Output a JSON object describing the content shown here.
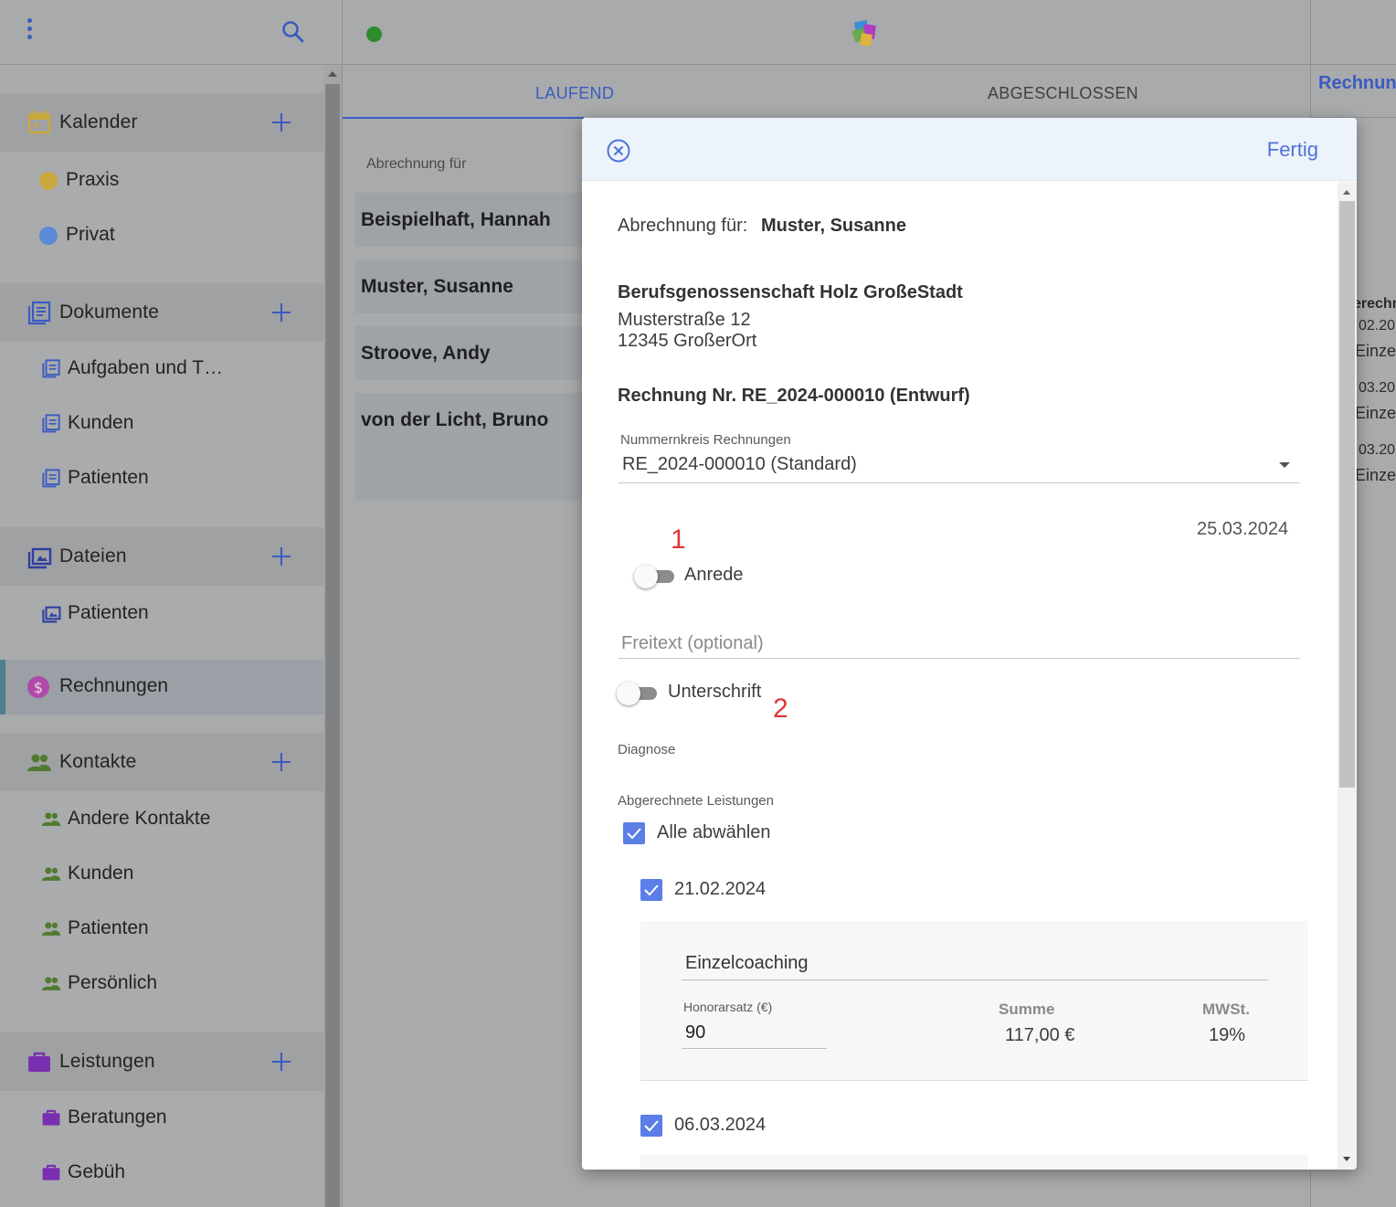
{
  "sidebar": {
    "groups": [
      {
        "label": "Kalender",
        "icon": "calendar-icon"
      },
      {
        "label": "Dokumente",
        "icon": "document-icon"
      },
      {
        "label": "Dateien",
        "icon": "files-icon"
      },
      {
        "label": "Kontakte",
        "icon": "contacts-icon"
      },
      {
        "label": "Leistungen",
        "icon": "briefcase-icon"
      }
    ],
    "calendars": [
      {
        "label": "Praxis",
        "color": "#c9a83f"
      },
      {
        "label": "Privat",
        "color": "#5b8ad6"
      }
    ],
    "documents": [
      {
        "label": "Aufgaben und T…"
      },
      {
        "label": "Kunden"
      },
      {
        "label": "Patienten"
      }
    ],
    "files": [
      {
        "label": "Patienten"
      }
    ],
    "active": {
      "label": "Rechnungen",
      "icon": "dollar-icon"
    },
    "contacts": [
      {
        "label": "Andere Kontakte"
      },
      {
        "label": "Kunden"
      },
      {
        "label": "Patienten"
      },
      {
        "label": "Persönlich"
      }
    ],
    "services": [
      {
        "label": "Beratungen"
      },
      {
        "label": "Gebüh"
      }
    ]
  },
  "middle": {
    "tabs": [
      {
        "label": "LAUFEND",
        "active": true
      },
      {
        "label": "ABGESCHLOSSEN",
        "active": false
      }
    ],
    "section_label": "Abrechnung für",
    "patients": [
      {
        "name": "Beispielhaft, Hannah"
      },
      {
        "name": "Muster, Susanne"
      },
      {
        "name": "Stroove, Andy"
      },
      {
        "name": "von der Licht, Bruno"
      }
    ]
  },
  "right_panel": {
    "title": "Rechnung",
    "partial_label": "erechn",
    "entries": [
      {
        "date": "02.20",
        "text": "Einze"
      },
      {
        "date": "03.20",
        "text": "Einze"
      },
      {
        "date": "03.20",
        "text": "Einze"
      }
    ]
  },
  "modal": {
    "done_label": "Fertig",
    "billing_prefix": "Abrechnung für:",
    "billing_name": "Muster, Susanne",
    "recipient": {
      "name": "Berufsgenossenschaft Holz GroßeStadt",
      "street": "Musterstraße 12",
      "city": "12345 GroßerOrt"
    },
    "invoice_title": "Rechnung Nr. RE_2024-000010 (Entwurf)",
    "number_range": {
      "label": "Nummernkreis Rechnungen",
      "value": "RE_2024-000010 (Standard)"
    },
    "date": "25.03.2024",
    "salutation_toggle": {
      "label": "Anrede",
      "on": false
    },
    "freitext_placeholder": "Freitext (optional)",
    "signature_toggle": {
      "label": "Unterschrift",
      "on": false
    },
    "diagnosis_label": "Diagnose",
    "services_label": "Abgerechnete Leistungen",
    "select_all_label": "Alle abwählen",
    "annotations": [
      "1",
      "2"
    ],
    "entries": [
      {
        "date": "21.02.2024",
        "checked": true,
        "service": "Einzelcoaching",
        "fee_label": "Honorarsatz (€)",
        "fee_value": "90",
        "sum_label": "Summe",
        "sum_value": "117,00 €",
        "vat_label": "MWSt.",
        "vat_value": "19%"
      },
      {
        "date": "06.03.2024",
        "checked": true
      }
    ]
  },
  "colors": {
    "accent": "#3b5bbf",
    "checkbox": "#5b7fe6",
    "annotation": "#e0363a",
    "status_online": "#2e8b2e"
  }
}
